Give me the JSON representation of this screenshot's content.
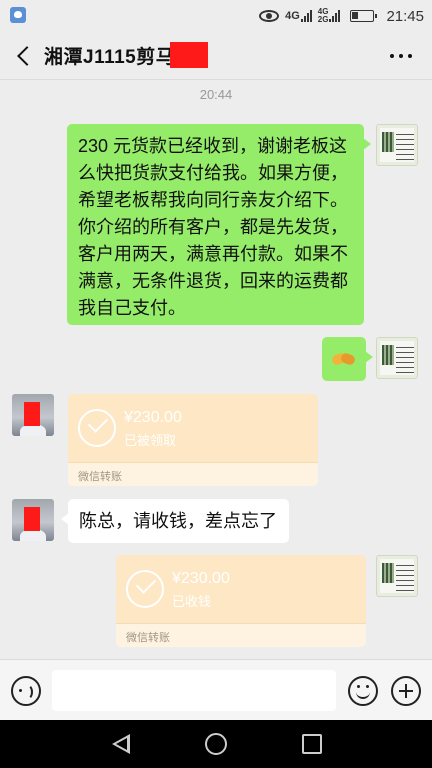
{
  "status_bar": {
    "network_primary": "4G",
    "network_secondary_top": "4G",
    "network_secondary_bottom": "2G",
    "time": "21:45",
    "icons": [
      "app-icon",
      "eye-icon",
      "signal-icon",
      "battery-icon"
    ]
  },
  "header": {
    "title": "湘潭J1115剪马"
  },
  "chat": {
    "time_separator": "20:44",
    "messages": [
      {
        "side": "right",
        "type": "text",
        "text": "230 元货款已经收到，谢谢老板这么快把货款支付给我。如果方便，希望老板帮我向同行亲友介绍下。你介绍的所有客户，都是先发货，客户用两天，满意再付款。如果不满意，无条件退货，回来的运费都我自己支付。"
      },
      {
        "side": "right",
        "type": "emoji",
        "emoji": "handshake-icon"
      },
      {
        "side": "left",
        "type": "transfer",
        "amount": "¥230.00",
        "status": "已被领取",
        "footer": "微信转账"
      },
      {
        "side": "left",
        "type": "text",
        "text": "陈总，请收钱，差点忘了"
      },
      {
        "side": "right",
        "type": "transfer",
        "amount": "¥230.00",
        "status": "已收钱",
        "footer": "微信转账"
      }
    ]
  },
  "input_bar": {
    "value": "",
    "icons": [
      "voice-icon",
      "emoji-icon",
      "plus-icon"
    ]
  },
  "nav_bar": {
    "icons": [
      "nav-back-icon",
      "nav-home-icon",
      "nav-recent-icon"
    ]
  },
  "colors": {
    "background": "#ededed",
    "green_bubble": "#95ec69",
    "transfer_card": "#fde7c4",
    "redaction": "#ff1a1a"
  }
}
